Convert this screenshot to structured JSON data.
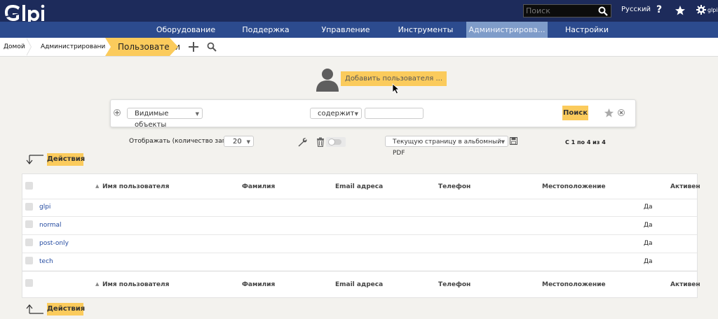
{
  "app": {
    "logo": "Glpi"
  },
  "topbar": {
    "search_placeholder": "Поиск",
    "language": "Русский",
    "help_icon": "?",
    "user": "glpi"
  },
  "menu": [
    {
      "label": "Оборудование",
      "active": false
    },
    {
      "label": "Поддержка",
      "active": false
    },
    {
      "label": "Управление",
      "active": false
    },
    {
      "label": "Инструменты",
      "active": false
    },
    {
      "label": "Администрирова...",
      "active": true
    },
    {
      "label": "Настройки",
      "active": false
    }
  ],
  "breadcrumb": [
    {
      "label": "Домой"
    },
    {
      "label": "Администрирование"
    },
    {
      "label": "Пользователи"
    }
  ],
  "actions": {
    "add_user": "Добавить пользователя ..."
  },
  "search": {
    "field": "Видимые объекты",
    "operator": "содержит",
    "value": "",
    "button": "Поиск"
  },
  "list": {
    "display_label": "Отображать (количество записей)",
    "page_size": "20",
    "export": "Текущую страницу в альбомный PDF",
    "pagination": "С 1 по 4 из 4",
    "actions_top": "Действия",
    "actions_bottom": "Действия"
  },
  "table": {
    "columns": [
      "Имя пользователя",
      "Фамилия",
      "Email адреса",
      "Телефон",
      "Местоположение",
      "Активен"
    ],
    "rows": [
      {
        "username": "glpi",
        "active": "Да"
      },
      {
        "username": "normal",
        "active": "Да"
      },
      {
        "username": "post-only",
        "active": "Да"
      },
      {
        "username": "tech",
        "active": "Да"
      }
    ]
  },
  "colors": {
    "topbar": "#1d2b5b",
    "menubar": "#2c4b8e",
    "active_menu": "#7f9cc9",
    "accent": "#fbcb5c",
    "link": "#234aa0"
  }
}
